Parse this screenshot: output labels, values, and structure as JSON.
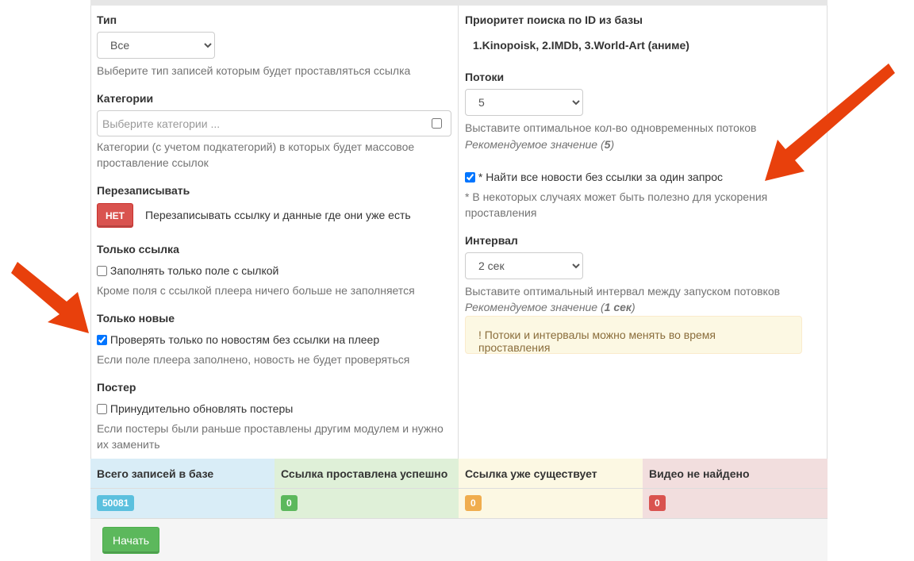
{
  "left": {
    "type": {
      "label": "Тип",
      "selected": "Все",
      "help": "Выберите тип записей которым будет проставляться ссылка"
    },
    "categories": {
      "label": "Категории",
      "placeholder": "Выберите категории ...",
      "help": "Категории (с учетом подкатегорий) в которых будет массовое проставление ссылок"
    },
    "overwrite": {
      "label": "Перезаписывать",
      "toggle": "НЕТ",
      "text": "Перезаписывать ссылку и данные где они уже есть"
    },
    "link_only": {
      "label": "Только ссылка",
      "checkbox": "Заполнять только поле с сылкой",
      "checked": false,
      "help": "Кроме поля с ссылкой плеера ничего больше не заполняется"
    },
    "only_new": {
      "label": "Только новые",
      "checkbox": "Проверять только по новостям без ссылки на плеер",
      "checked": true,
      "help": "Если поле плеера заполнено, новость не будет проверяться"
    },
    "poster": {
      "label": "Постер",
      "checkbox": "Принудительно обновлять постеры",
      "checked": false,
      "help": "Если постеры были раньше проставлены другим модулем и нужно их заменить"
    }
  },
  "right": {
    "priority": {
      "label": "Приоритет поиска по ID из базы",
      "value": "1.Kinopoisk, 2.IMDb, 3.World-Art (аниме)"
    },
    "threads": {
      "label": "Потоки",
      "selected": "5",
      "help": "Выставите оптимальное кол-во одновременных потоков",
      "recommend_prefix": "Рекомендуемое значение (",
      "recommend_value": "5",
      "recommend_suffix": ")"
    },
    "find_all": {
      "checkbox": "* Найти все новости без ссылки за один запрос",
      "checked": true,
      "help": "* В некоторых случаях может быть полезно для ускорения проставления"
    },
    "interval": {
      "label": "Интервал",
      "selected": "2 сек",
      "help": "Выставите оптимальный интервал между запуском потовков",
      "recommend_prefix": "Рекомендуемое значение (",
      "recommend_value": "1 сек",
      "recommend_suffix": ")"
    },
    "alert": "! Потоки и интервалы можно менять во время проставления"
  },
  "stats": {
    "total": {
      "label": "Всего записей в базе",
      "value": "50081",
      "color": "#5bc0de",
      "bg": "#d9edf7"
    },
    "success": {
      "label": "Ссылка проставлена успешно",
      "value": "0",
      "color": "#5cb85c",
      "bg": "#dff0d8"
    },
    "exists": {
      "label": "Ссылка уже существует",
      "value": "0",
      "color": "#f0ad4e",
      "bg": "#fcf8e3"
    },
    "not_found": {
      "label": "Видео не найдено",
      "value": "0",
      "color": "#d9534f",
      "bg": "#f2dede"
    }
  },
  "start_button": "Начать",
  "colors": {
    "arrow": "#e8400c"
  }
}
